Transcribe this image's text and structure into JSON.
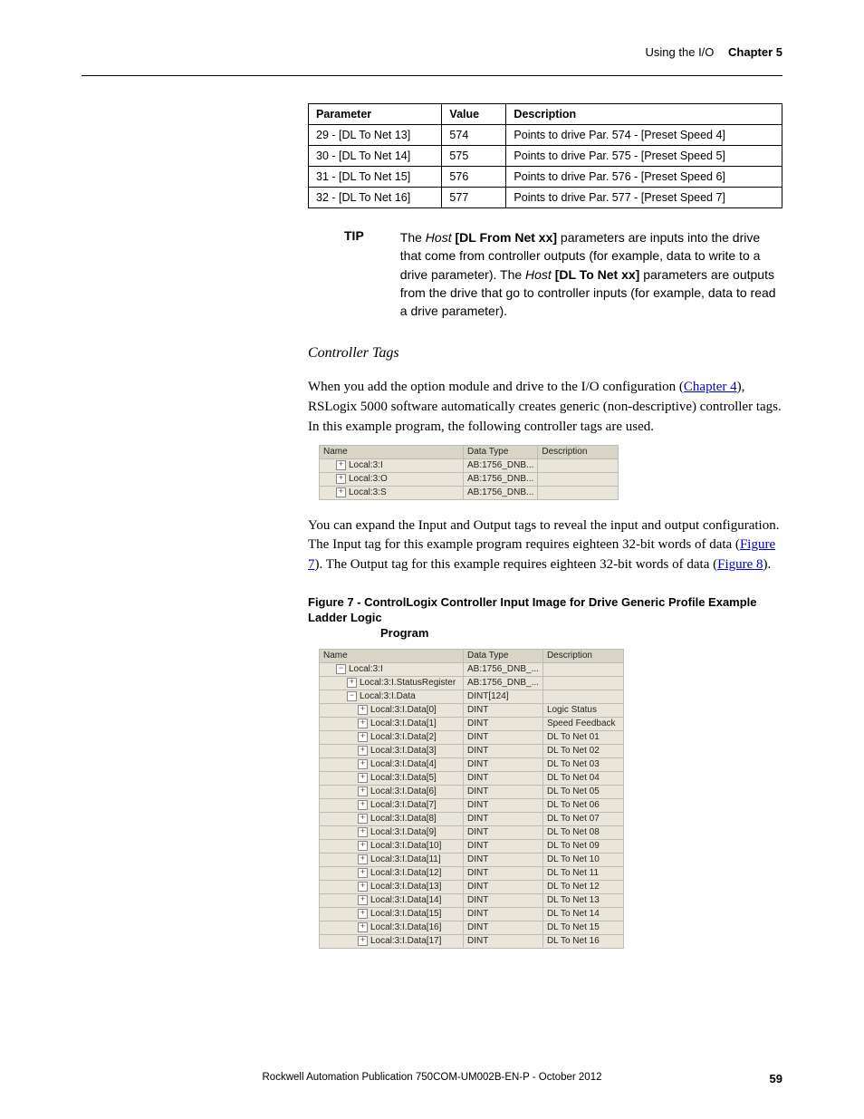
{
  "header": {
    "section": "Using the I/O",
    "chapter": "Chapter 5"
  },
  "param_table": {
    "headers": [
      "Parameter",
      "Value",
      "Description"
    ],
    "rows": [
      {
        "param": "29 - [DL To Net 13]",
        "value": "574",
        "desc": "Points to drive Par. 574 - [Preset Speed 4]"
      },
      {
        "param": "30 - [DL To Net 14]",
        "value": "575",
        "desc": "Points to drive Par. 575 - [Preset Speed 5]"
      },
      {
        "param": "31 - [DL To Net 15]",
        "value": "576",
        "desc": "Points to drive Par. 576 - [Preset Speed 6]"
      },
      {
        "param": "32 - [DL To Net 16]",
        "value": "577",
        "desc": "Points to drive Par. 577 - [Preset Speed 7]"
      }
    ]
  },
  "tip": {
    "label": "TIP",
    "para": {
      "p1a": "The ",
      "p1_host1": "Host",
      "p1b": " ",
      "p1_bold1": "[DL From Net xx]",
      "p1c": " parameters are inputs into the drive that come from controller outputs (for example, data to write to a drive parameter). The ",
      "p1_host2": "Host",
      "p1d": " ",
      "p1_bold2": "[DL To Net xx]",
      "p1e": " parameters are outputs from the drive that go to controller inputs (for example, data to read a drive parameter)."
    }
  },
  "subtitle": "Controller Tags",
  "para1": {
    "a": "When you add the option module and drive to the I/O configuration (",
    "link": "Chapter 4",
    "b": "), RSLogix 5000 software automatically creates generic (non-descriptive) controller tags. In this example program, the following controller tags are used."
  },
  "tags_table": {
    "headers": [
      "Name",
      "Data Type",
      "Description"
    ],
    "rows": [
      {
        "exp": "+",
        "pad": "pad1",
        "name": "Local:3:I",
        "dt": "AB:1756_DNB...",
        "desc": ""
      },
      {
        "exp": "+",
        "pad": "pad1",
        "name": "Local:3:O",
        "dt": "AB:1756_DNB...",
        "desc": ""
      },
      {
        "exp": "+",
        "pad": "pad1",
        "name": "Local:3:S",
        "dt": "AB:1756_DNB...",
        "desc": ""
      }
    ]
  },
  "para2": {
    "a": "You can expand the Input and Output tags to reveal the input and output configuration. The Input tag for this example program requires eighteen 32-bit words of data (",
    "link1": "Figure 7",
    "b": "). The Output tag for this example requires eighteen 32-bit words of data (",
    "link2": "Figure 8",
    "c": ")."
  },
  "figure7": {
    "caption_line1": "Figure 7 - ControlLogix Controller Input Image for Drive Generic Profile Example Ladder Logic",
    "caption_line2": "Program",
    "headers": [
      "Name",
      "Data Type",
      "Description"
    ],
    "rows": [
      {
        "exp": "−",
        "pad": "pad1",
        "name": "Local:3:I",
        "dt": "AB:1756_DNB_...",
        "desc": ""
      },
      {
        "exp": "+",
        "pad": "pad2",
        "name": "Local:3:I.StatusRegister",
        "dt": "AB:1756_DNB_...",
        "desc": ""
      },
      {
        "exp": "−",
        "pad": "pad2",
        "name": "Local:3:I.Data",
        "dt": "DINT[124]",
        "desc": ""
      },
      {
        "exp": "+",
        "pad": "pad3",
        "name": "Local:3:I.Data[0]",
        "dt": "DINT",
        "desc": "Logic Status"
      },
      {
        "exp": "+",
        "pad": "pad3",
        "name": "Local:3:I.Data[1]",
        "dt": "DINT",
        "desc": "Speed Feedback"
      },
      {
        "exp": "+",
        "pad": "pad3",
        "name": "Local:3:I.Data[2]",
        "dt": "DINT",
        "desc": "DL To Net 01"
      },
      {
        "exp": "+",
        "pad": "pad3",
        "name": "Local:3:I.Data[3]",
        "dt": "DINT",
        "desc": "DL To Net 02"
      },
      {
        "exp": "+",
        "pad": "pad3",
        "name": "Local:3:I.Data[4]",
        "dt": "DINT",
        "desc": "DL To Net 03"
      },
      {
        "exp": "+",
        "pad": "pad3",
        "name": "Local:3:I.Data[5]",
        "dt": "DINT",
        "desc": "DL To Net 04"
      },
      {
        "exp": "+",
        "pad": "pad3",
        "name": "Local:3:I.Data[6]",
        "dt": "DINT",
        "desc": "DL To Net 05"
      },
      {
        "exp": "+",
        "pad": "pad3",
        "name": "Local:3:I.Data[7]",
        "dt": "DINT",
        "desc": "DL To Net 06"
      },
      {
        "exp": "+",
        "pad": "pad3",
        "name": "Local:3:I.Data[8]",
        "dt": "DINT",
        "desc": "DL To Net 07"
      },
      {
        "exp": "+",
        "pad": "pad3",
        "name": "Local:3:I.Data[9]",
        "dt": "DINT",
        "desc": "DL To Net 08"
      },
      {
        "exp": "+",
        "pad": "pad3",
        "name": "Local:3:I.Data[10]",
        "dt": "DINT",
        "desc": "DL To Net 09"
      },
      {
        "exp": "+",
        "pad": "pad3",
        "name": "Local:3:I.Data[11]",
        "dt": "DINT",
        "desc": "DL To Net 10"
      },
      {
        "exp": "+",
        "pad": "pad3",
        "name": "Local:3:I.Data[12]",
        "dt": "DINT",
        "desc": "DL To Net 11"
      },
      {
        "exp": "+",
        "pad": "pad3",
        "name": "Local:3:I.Data[13]",
        "dt": "DINT",
        "desc": "DL To Net 12"
      },
      {
        "exp": "+",
        "pad": "pad3",
        "name": "Local:3:I.Data[14]",
        "dt": "DINT",
        "desc": "DL To Net 13"
      },
      {
        "exp": "+",
        "pad": "pad3",
        "name": "Local:3:I.Data[15]",
        "dt": "DINT",
        "desc": "DL To Net 14"
      },
      {
        "exp": "+",
        "pad": "pad3",
        "name": "Local:3:I.Data[16]",
        "dt": "DINT",
        "desc": "DL To Net 15"
      },
      {
        "exp": "+",
        "pad": "pad3",
        "name": "Local:3:I.Data[17]",
        "dt": "DINT",
        "desc": "DL To Net 16"
      }
    ]
  },
  "footer": {
    "text": "Rockwell Automation Publication 750COM-UM002B-EN-P - October 2012",
    "page": "59"
  }
}
